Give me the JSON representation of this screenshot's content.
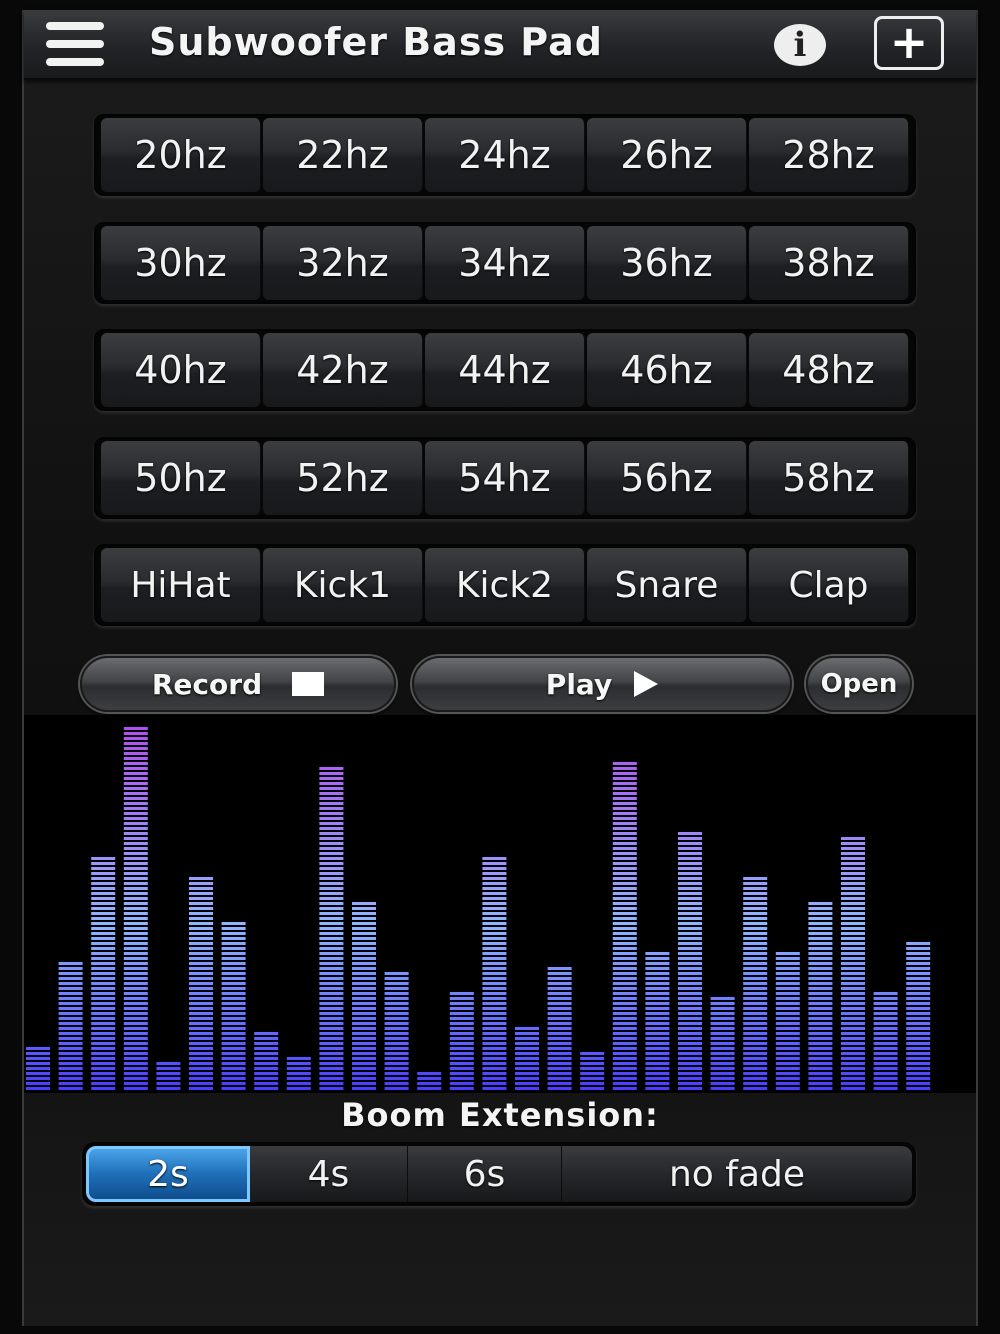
{
  "header": {
    "title": "Subwoofer Bass Pad",
    "info_label": "i",
    "add_label": "+"
  },
  "pad_rows": [
    [
      "20hz",
      "22hz",
      "24hz",
      "26hz",
      "28hz"
    ],
    [
      "30hz",
      "32hz",
      "34hz",
      "36hz",
      "38hz"
    ],
    [
      "40hz",
      "42hz",
      "44hz",
      "46hz",
      "48hz"
    ],
    [
      "50hz",
      "52hz",
      "54hz",
      "56hz",
      "58hz"
    ]
  ],
  "sound_pads": [
    "HiHat",
    "Kick1",
    "Kick2",
    "Snare",
    "Clap"
  ],
  "controls": {
    "record_label": "Record",
    "play_label": "Play",
    "open_label": "Open"
  },
  "equalizer": {
    "levels": [
      0.12,
      0.35,
      0.65,
      1.0,
      0.08,
      0.59,
      0.47,
      0.17,
      0.1,
      0.89,
      0.52,
      0.33,
      0.05,
      0.28,
      0.64,
      0.18,
      0.34,
      0.11,
      0.9,
      0.39,
      0.71,
      0.26,
      0.59,
      0.38,
      0.52,
      0.7,
      0.27,
      0.41
    ]
  },
  "boom_extension": {
    "label": "Boom Extension:",
    "options": [
      "2s",
      "4s",
      "6s",
      "no fade"
    ],
    "selected": "2s"
  },
  "colors": {
    "bar_bottom": "#4a3cff",
    "bar_mid": "#8fb6ff",
    "bar_top": "#b24cf0",
    "selected_option": "#1f6fb8"
  },
  "icons": {
    "menu": "hamburger-icon",
    "info": "info-icon",
    "add": "plus-icon",
    "record": "stop-square-icon",
    "play": "play-triangle-icon"
  }
}
